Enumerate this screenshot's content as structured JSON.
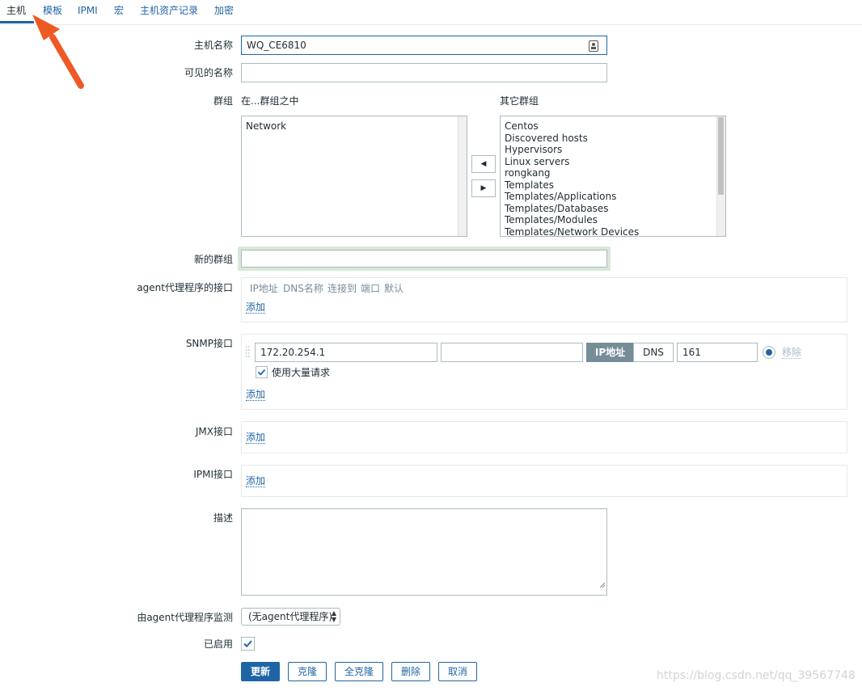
{
  "tabs": [
    {
      "label": "主机"
    },
    {
      "label": "模板"
    },
    {
      "label": "IPMI"
    },
    {
      "label": "宏"
    },
    {
      "label": "主机资产记录"
    },
    {
      "label": "加密"
    }
  ],
  "form": {
    "host_name_label": "主机名称",
    "host_name_value": "WQ_CE6810",
    "visible_name_label": "可见的名称",
    "visible_name_value": "",
    "groups_label": "群组",
    "in_groups_label": "在...群组之中",
    "other_groups_label": "其它群组",
    "in_groups": [
      "Network"
    ],
    "other_groups": [
      "Centos",
      "Discovered hosts",
      "Hypervisors",
      "Linux servers",
      "rongkang",
      "Templates",
      "Templates/Applications",
      "Templates/Databases",
      "Templates/Modules",
      "Templates/Network Devices"
    ],
    "new_group_label": "新的群组",
    "new_group_value": "",
    "agent_label": "agent代理程序的接口",
    "interface_columns": {
      "ip": "IP地址",
      "dns": "DNS名称",
      "connect": "连接到",
      "port": "端口",
      "default": "默认"
    },
    "add_link": "添加",
    "snmp_label": "SNMP接口",
    "snmp_ip": "172.20.254.1",
    "snmp_dns": "",
    "snmp_connect_ip": "IP地址",
    "snmp_connect_dns": "DNS",
    "snmp_port": "161",
    "snmp_remove": "移除",
    "snmp_bulk_label": "使用大量请求",
    "jmx_label": "JMX接口",
    "ipmi_label": "IPMI接口",
    "description_label": "描述",
    "description_value": "",
    "proxy_label": "由agent代理程序监测",
    "proxy_value": "(无agent代理程序)",
    "enabled_label": "已启用"
  },
  "buttons": {
    "update": "更新",
    "clone": "克隆",
    "full_clone": "全克隆",
    "delete": "删除",
    "cancel": "取消"
  },
  "watermark": "https://blog.csdn.net/qq_39567748",
  "colors": {
    "accent": "#1f65a6",
    "arrow": "#ee5a24"
  }
}
